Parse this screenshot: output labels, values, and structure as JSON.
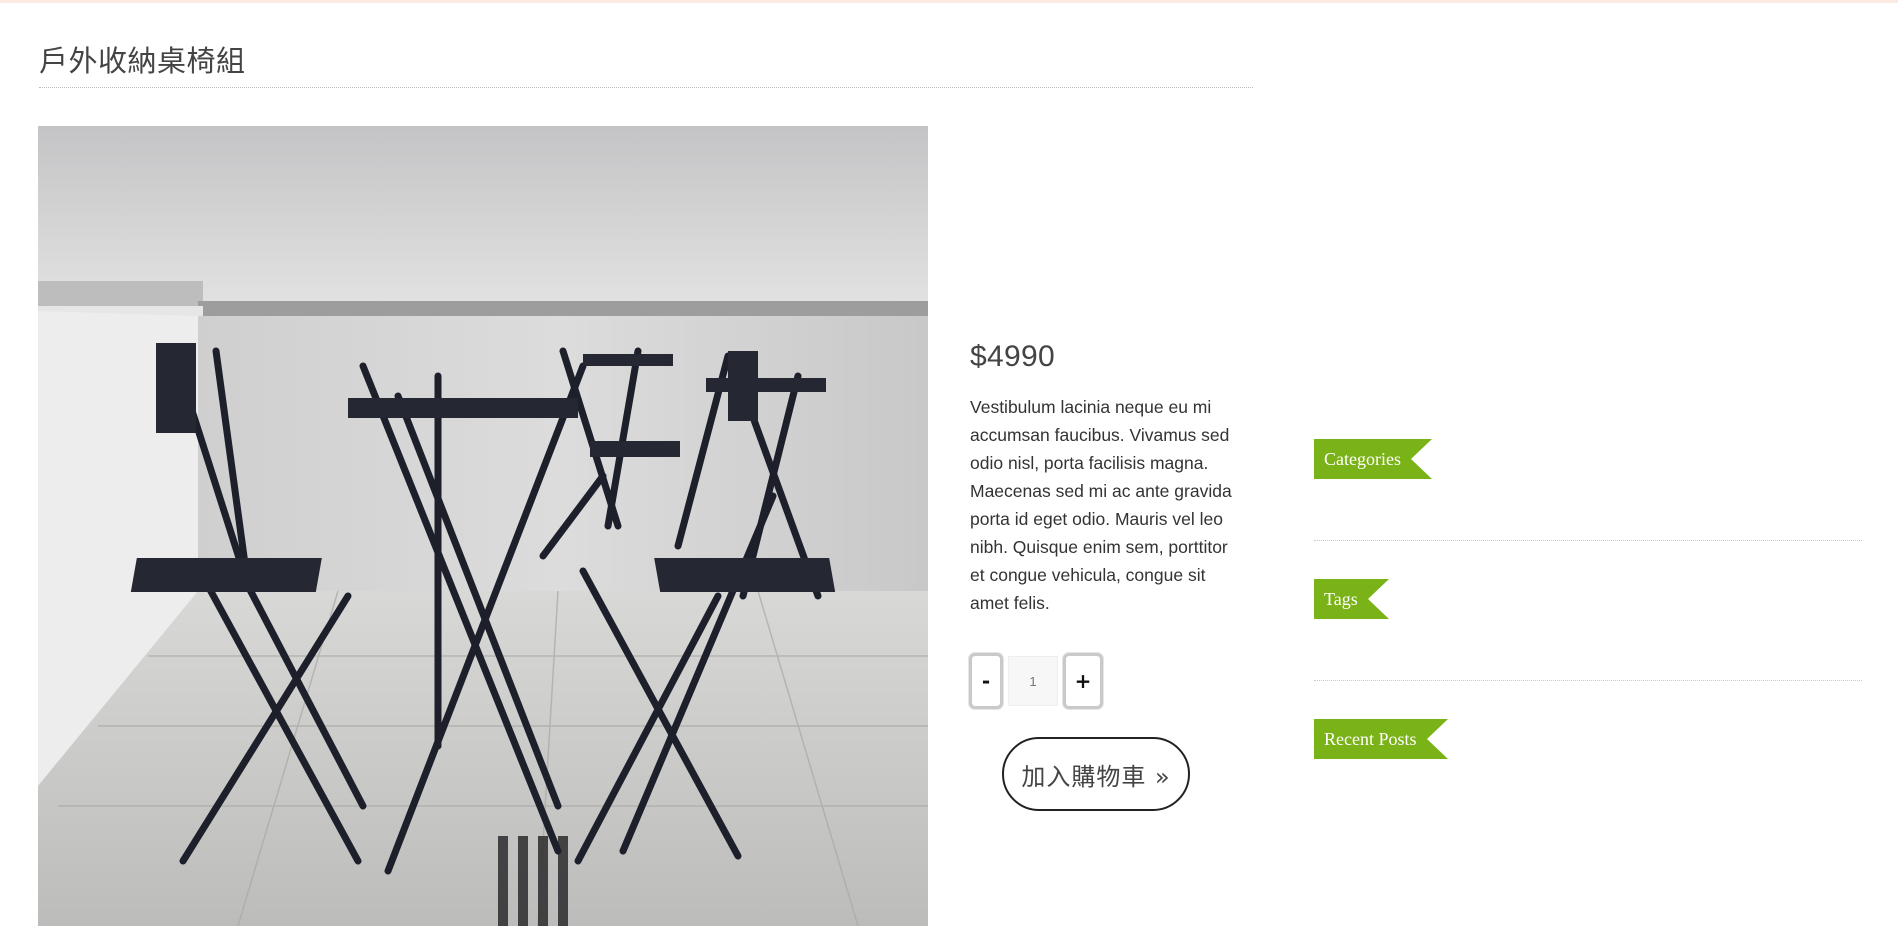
{
  "product": {
    "title": "戶外收納桌椅組",
    "price": "$4990",
    "description": "Vestibulum lacinia neque eu mi accumsan faucibus. Vivamus sed odio nisl, porta facilisis magna. Maecenas sed mi ac ante gravida porta id eget odio. Mauris vel leo nibh. Quisque enim sem, porttitor et congue vehicula, congue sit amet felis.",
    "image_alt": "product-photo-folding-table-chairs"
  },
  "quantity": {
    "minus_label": "-",
    "plus_label": "+",
    "placeholder": "1"
  },
  "cart": {
    "add_label": "加入購物車 »"
  },
  "sidebar": {
    "widgets": [
      {
        "title": "Categories"
      },
      {
        "title": "Tags"
      },
      {
        "title": "Recent Posts"
      }
    ]
  },
  "colors": {
    "accent_green": "#7ab317",
    "top_strip": "#fbe9e2"
  }
}
